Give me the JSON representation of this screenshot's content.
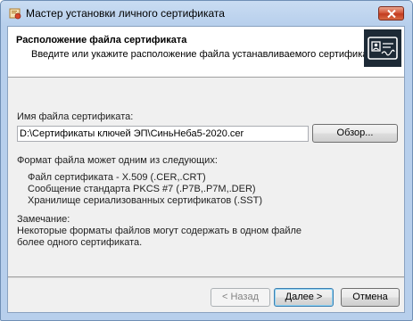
{
  "window": {
    "title": "Мастер установки личного сертификата"
  },
  "header": {
    "title": "Расположение файла сертификата",
    "subtitle": "Введите или укажите расположение файла устанавливаемого сертификата"
  },
  "file": {
    "label": "Имя файла сертификата:",
    "value": "D:\\Сертификаты ключей ЭП\\СиньНеба5-2020.cer",
    "browse_label": "Обзор..."
  },
  "formats": {
    "heading": "Формат файла может одним из следующих:",
    "items": [
      "Файл сертификата - X.509 (.CER,.CRT)",
      "Сообщение стандарта PKCS #7 (.P7B,.P7M,.DER)",
      "Хранилище сериализованных сертификатов (.SST)"
    ]
  },
  "note": {
    "heading": "Замечание:",
    "line1": "Некоторые форматы файлов могут содержать в одном файле",
    "line2": "более одного сертификата."
  },
  "buttons": {
    "back": "< Назад",
    "next": "Далее >",
    "cancel": "Отмена"
  }
}
